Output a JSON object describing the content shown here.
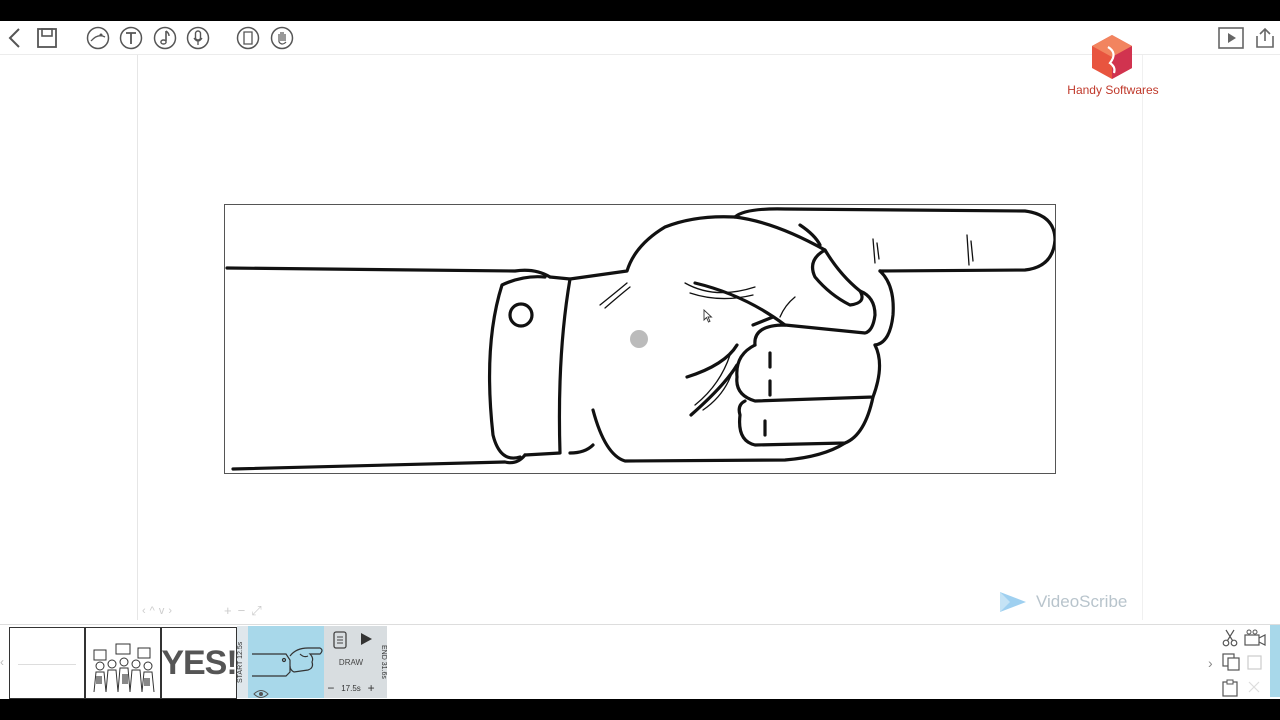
{
  "toolbar": {
    "back_icon": "chevron-left-icon",
    "save_icon": "save-icon",
    "tools": [
      "image-icon",
      "text-icon",
      "music-icon",
      "microphone-icon",
      "background-icon",
      "hand-icon"
    ],
    "play_icon": "play-preview-icon",
    "share_icon": "share-icon"
  },
  "branding": {
    "logo_icon": "handy-softwares-logo",
    "name": "Handy Softwares",
    "color": "#c0392b"
  },
  "canvas": {
    "watermark_text": "VideoScribe",
    "nav_glyphs": [
      "‹",
      "^",
      "v",
      "›"
    ],
    "zoom_glyphs": [
      "+",
      "−",
      "⤢"
    ]
  },
  "timeline": {
    "thumbs": [
      {
        "label": "",
        "kind": "blank"
      },
      {
        "label": "",
        "kind": "crowd"
      },
      {
        "label": "YES!",
        "kind": "text"
      }
    ],
    "selected": {
      "start_label": "START 12.5s",
      "end_label": "END 31.6s",
      "mode": "DRAW",
      "duration": "17.5s",
      "minus": "−",
      "plus": "+"
    },
    "right_tools": [
      "scissors-icon",
      "camera-icon",
      "copy-icon",
      "paste-icon",
      "clipboard-icon"
    ]
  }
}
